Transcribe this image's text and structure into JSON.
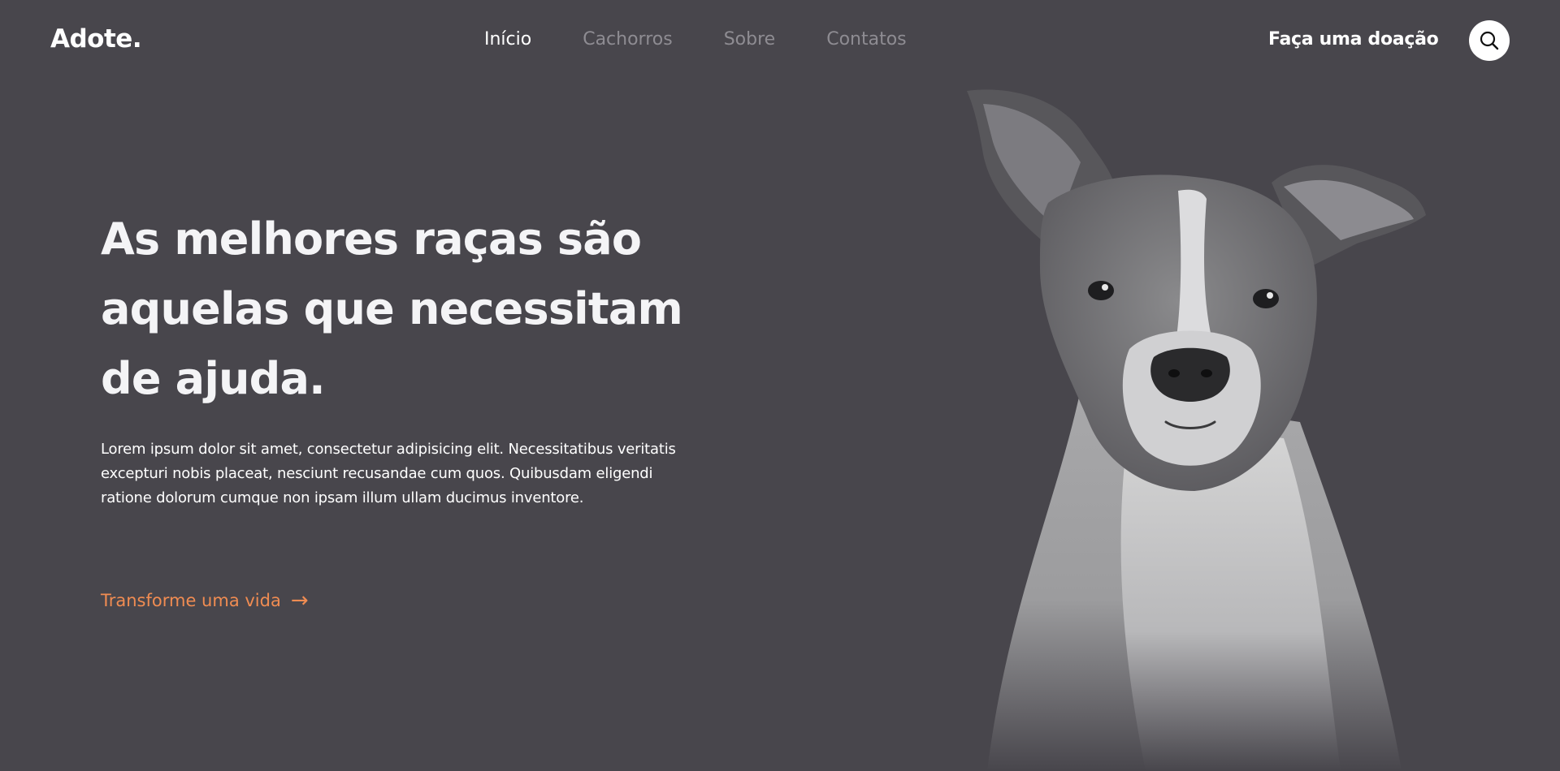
{
  "header": {
    "logo": "Adote.",
    "nav": [
      {
        "label": "Início",
        "active": true
      },
      {
        "label": "Cachorros",
        "active": false
      },
      {
        "label": "Sobre",
        "active": false
      },
      {
        "label": "Contatos",
        "active": false
      }
    ],
    "donate_label": "Faça uma doação",
    "search_icon": "search-icon"
  },
  "hero": {
    "headline": "As melhores raças são aquelas que necessitam de ajuda.",
    "description": "Lorem ipsum dolor sit amet, consectetur adipisicing elit. Necessitatibus veritatis excepturi nobis placeat, nesciunt recusandae cum quos. Quibusdam eligendi ratione dolorum cumque non ipsam illum ullam ducimus inventore.",
    "cta_label": "Transforme uma vida",
    "cta_arrow": "→",
    "image": "dog-photo"
  },
  "colors": {
    "background": "#48464c",
    "text": "#ffffff",
    "nav_inactive": "#8e8c92",
    "accent": "#f08c52"
  }
}
